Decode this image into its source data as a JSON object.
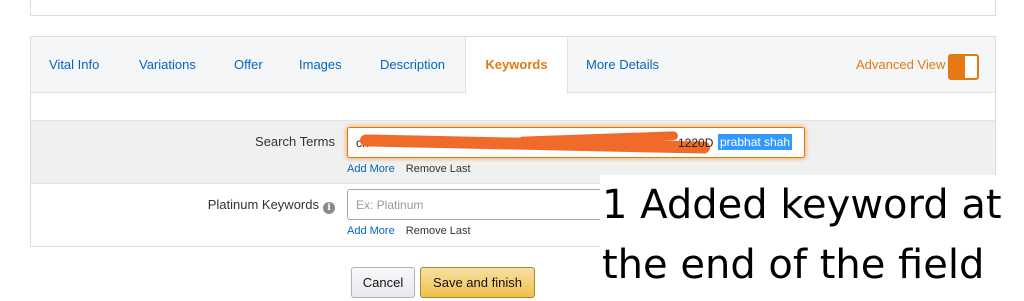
{
  "tabs": [
    {
      "label": "Vital Info"
    },
    {
      "label": "Variations"
    },
    {
      "label": "Offer"
    },
    {
      "label": "Images"
    },
    {
      "label": "Description"
    },
    {
      "label": "Keywords",
      "active": true
    },
    {
      "label": "More Details"
    }
  ],
  "advanced_view": {
    "label": "Advanced View",
    "enabled": true
  },
  "fields": {
    "search_terms": {
      "label": "Search Terms",
      "value_prefix": "ch",
      "value_tail": "1220D",
      "value_selected": "prabhat shah",
      "add_more": "Add More",
      "remove_last": "Remove Last"
    },
    "platinum_keywords": {
      "label": "Platinum Keywords",
      "info_icon": "i",
      "placeholder": "Ex: Platinum",
      "add_more": "Add More",
      "remove_last": "Remove Last"
    }
  },
  "buttons": {
    "cancel": "Cancel",
    "save": "Save and finish"
  },
  "annotation": {
    "line1": "1 Added keyword at",
    "line2": "the end of the field"
  },
  "colors": {
    "accent": "#e47911",
    "link": "#0066c0",
    "redaction": "#f06a2a",
    "selection": "#3399ff"
  }
}
